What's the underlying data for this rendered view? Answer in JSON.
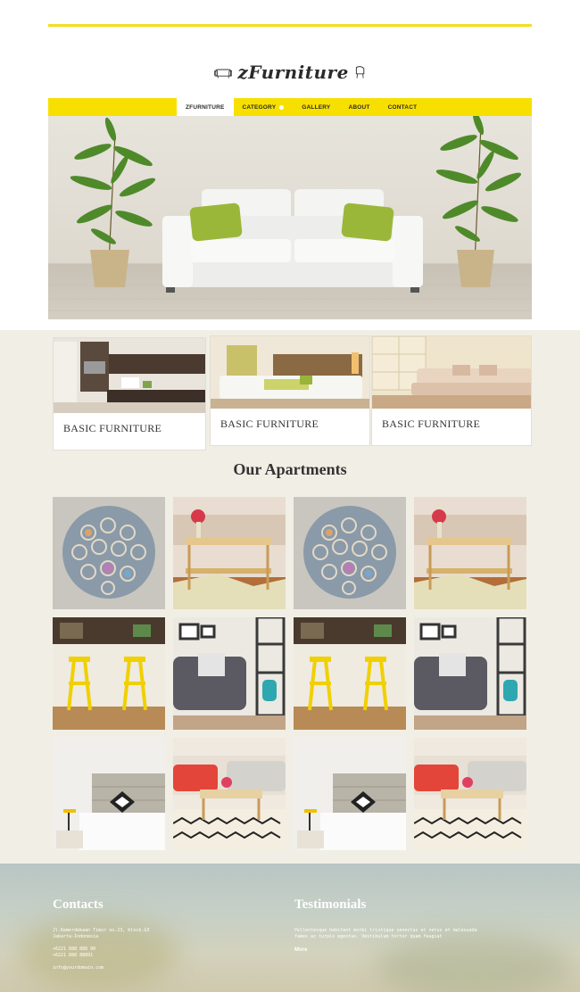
{
  "brand": {
    "logo_text": "zFurniture"
  },
  "nav": {
    "items": [
      "ZFURNITURE",
      "CATEGORY",
      "GALLERY",
      "ABOUT",
      "CONTACT"
    ]
  },
  "categories": [
    {
      "label": "BASIC FURNITURE",
      "image": "kitchen-photo"
    },
    {
      "label": "BASIC FURNITURE",
      "image": "bedroom-photo"
    },
    {
      "label": "BASIC FURNITURE",
      "image": "living-room-photo"
    }
  ],
  "apartments": {
    "title": "Our Apartments",
    "tiles": [
      "paper-ball-sculpture",
      "glass-coffee-table",
      "paper-ball-sculpture",
      "glass-coffee-table",
      "yellow-bar-stools",
      "gray-armchair-shelf",
      "yellow-bar-stools",
      "gray-armchair-shelf",
      "bedroom-lamp",
      "sofa-rug-table",
      "bedroom-lamp",
      "sofa-rug-table"
    ]
  },
  "footer": {
    "contacts_title": "Contacts",
    "address_line1": "Jl.Kemerdekaan Timur no.23, block.G3",
    "address_line2": "Jakarta-Indonesia",
    "phone1": "+6221 888 888 90",
    "phone2": "+6221 888 88891",
    "email": "info@yourdomain.com",
    "testimonials_title": "Testimonials",
    "testimonial_line1": "Pellentesque habitant morbi tristique senectus et netus et malesuada",
    "testimonial_line2": "fames ac turpis egestas. Vestibulum tortor quam feugiat",
    "more_label": "More"
  },
  "colors": {
    "accent": "#f7e000",
    "band": "#f1efe5"
  }
}
